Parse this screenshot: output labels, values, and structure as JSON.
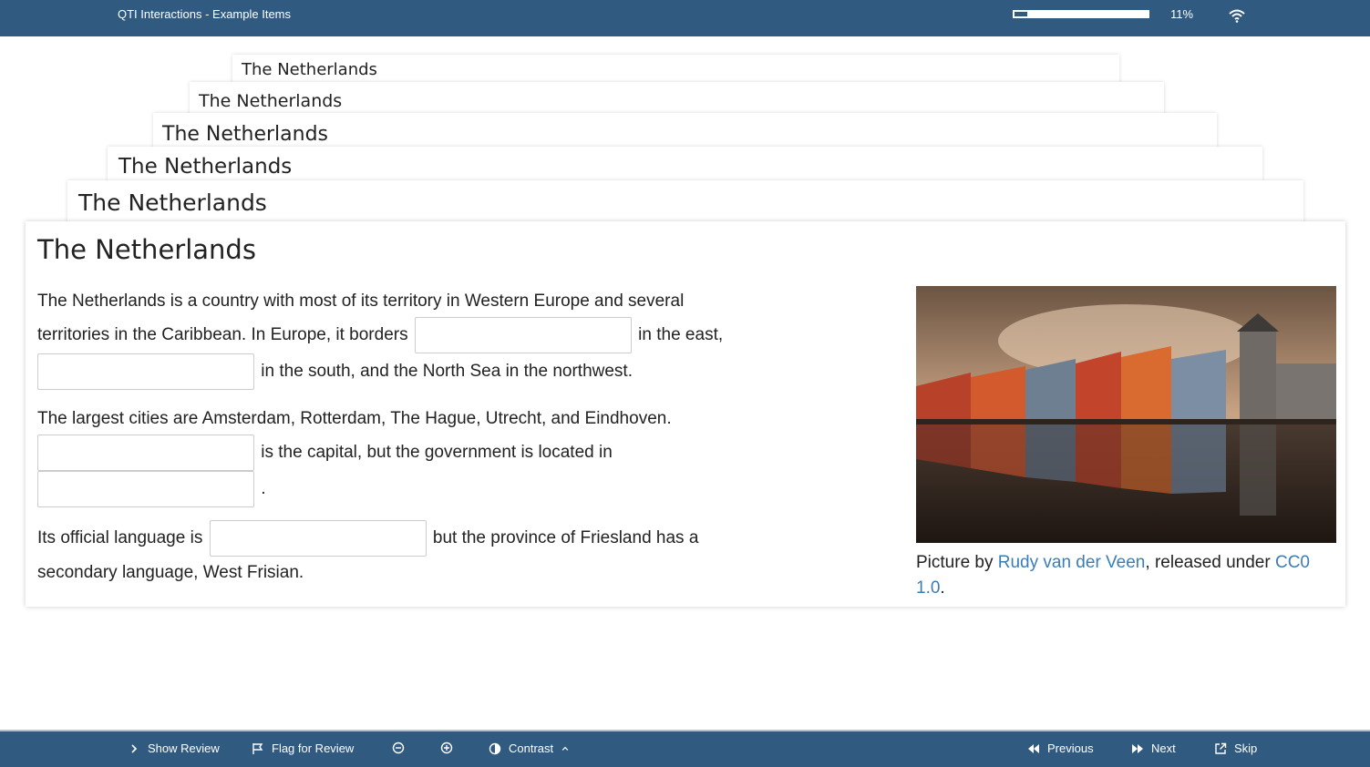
{
  "header": {
    "title": "QTI Interactions - Example Items",
    "progress_percent_label": "11%",
    "progress_fraction": 0.11,
    "wifi_icon": "wifi-icon"
  },
  "stack_titles": [
    "The Netherlands",
    "The Netherlands",
    "The Netherlands",
    "The Netherlands",
    "The Netherlands"
  ],
  "item": {
    "title": "The Netherlands",
    "p1_a": "The Netherlands is a country with most of its territory in Western Europe and several territories in the Caribbean. In Europe, it borders",
    "p1_b": "in the east,",
    "p1_c": "in the south, and the North Sea in the northwest.",
    "p2_a": "The largest cities are Amsterdam, Rotterdam, The Hague, Utrecht, and Eindhoven.",
    "p2_b": "is the capital, but the government is located in",
    "p2_c": ".",
    "p3_a": "Its official language is",
    "p3_b": "but the province of Friesland has a secondary language, West Frisian.",
    "caption_prefix": "Picture by ",
    "caption_author": "Rudy van der Veen",
    "caption_middle": ", released under ",
    "caption_license": "CC0 1.0",
    "caption_suffix": "."
  },
  "footer": {
    "show_review": "Show Review",
    "flag_review": "Flag for Review",
    "contrast": "Contrast",
    "previous": "Previous",
    "next": "Next",
    "skip": "Skip"
  },
  "colors": {
    "bar": "#305a80",
    "link": "#3a7db5"
  }
}
